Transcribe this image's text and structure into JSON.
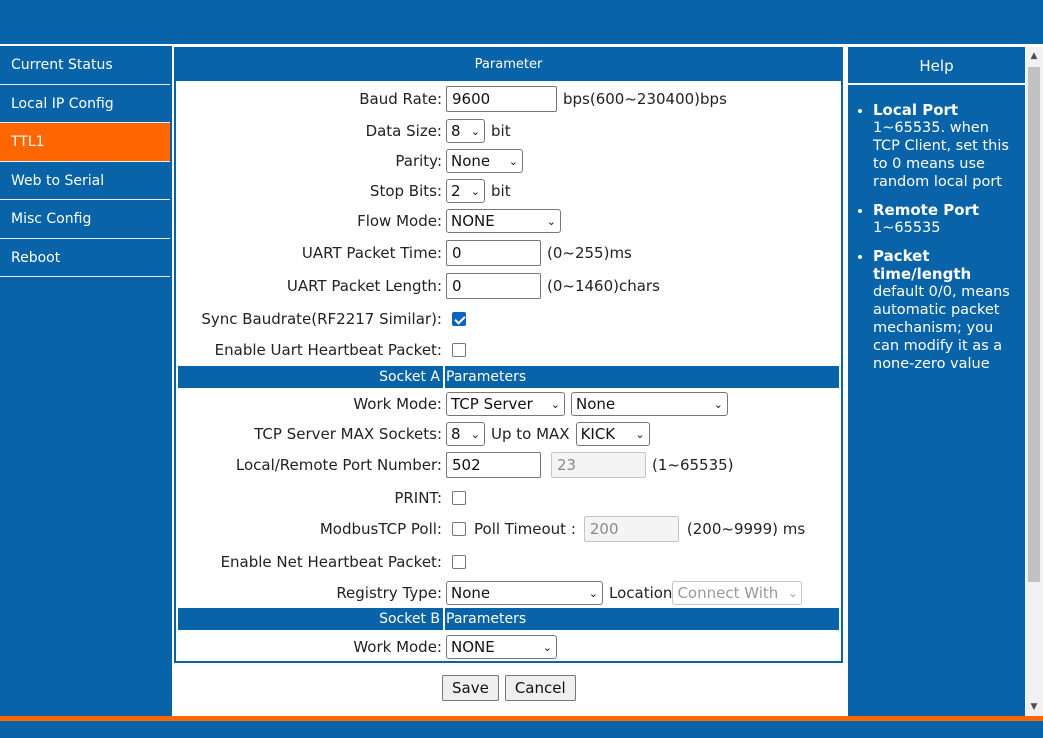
{
  "sidebar": {
    "items": [
      {
        "label": "Current Status"
      },
      {
        "label": "Local IP Config"
      },
      {
        "label": "TTL1",
        "active": true
      },
      {
        "label": "Web to Serial"
      },
      {
        "label": "Misc Config"
      },
      {
        "label": "Reboot"
      }
    ]
  },
  "panel": {
    "title": "Parameter",
    "baud_rate": {
      "label": "Baud Rate:",
      "value": "9600",
      "hint": "bps(600~230400)bps"
    },
    "data_size": {
      "label": "Data Size:",
      "value": "8",
      "unit": "bit"
    },
    "parity": {
      "label": "Parity:",
      "value": "None"
    },
    "stop_bits": {
      "label": "Stop Bits:",
      "value": "2",
      "unit": "bit"
    },
    "flow_mode": {
      "label": "Flow Mode:",
      "value": "NONE"
    },
    "uart_packet_time": {
      "label": "UART Packet Time:",
      "value": "0",
      "hint": "(0~255)ms"
    },
    "uart_packet_length": {
      "label": "UART Packet Length:",
      "value": "0",
      "hint": "(0~1460)chars"
    },
    "sync_baudrate": {
      "label": "Sync Baudrate(RF2217 Similar):",
      "checked": true
    },
    "uart_heartbeat": {
      "label": "Enable Uart Heartbeat Packet:",
      "checked": false
    },
    "socket_a": {
      "left": "Socket A",
      "right": "Parameters",
      "work_mode": {
        "label": "Work Mode:",
        "value": "TCP Server",
        "value2": "None"
      },
      "max_sockets": {
        "label": "TCP Server MAX Sockets:",
        "value": "8",
        "mid": "Up to MAX",
        "value2": "KICK"
      },
      "port": {
        "label": "Local/Remote Port Number:",
        "local": "502",
        "remote": "23",
        "hint": "(1~65535)"
      },
      "print": {
        "label": "PRINT:",
        "checked": false
      },
      "modbus": {
        "label": "ModbusTCP Poll:",
        "checked": false,
        "timeout_label": "Poll Timeout :",
        "timeout": "200",
        "hint": "(200~9999) ms"
      },
      "net_heartbeat": {
        "label": "Enable Net Heartbeat Packet:",
        "checked": false
      },
      "registry": {
        "label": "Registry Type:",
        "value": "None",
        "location_label": "Location",
        "location": "Connect With"
      }
    },
    "socket_b": {
      "left": "Socket B",
      "right": "Parameters",
      "work_mode": {
        "label": "Work Mode:",
        "value": "NONE"
      }
    }
  },
  "actions": {
    "save": "Save",
    "cancel": "Cancel"
  },
  "help": {
    "title": "Help",
    "items": [
      {
        "title": "Local Port",
        "text": "1~65535. when TCP Client, set this to 0 means use random local port"
      },
      {
        "title": "Remote Port",
        "text": "1~65535"
      },
      {
        "title": "Packet time/length",
        "text": "default 0/0, means automatic packet mechanism; you can modify it as a none-zero value"
      }
    ]
  },
  "colors": {
    "primary": "#0863a8",
    "accent": "#ff6600"
  }
}
